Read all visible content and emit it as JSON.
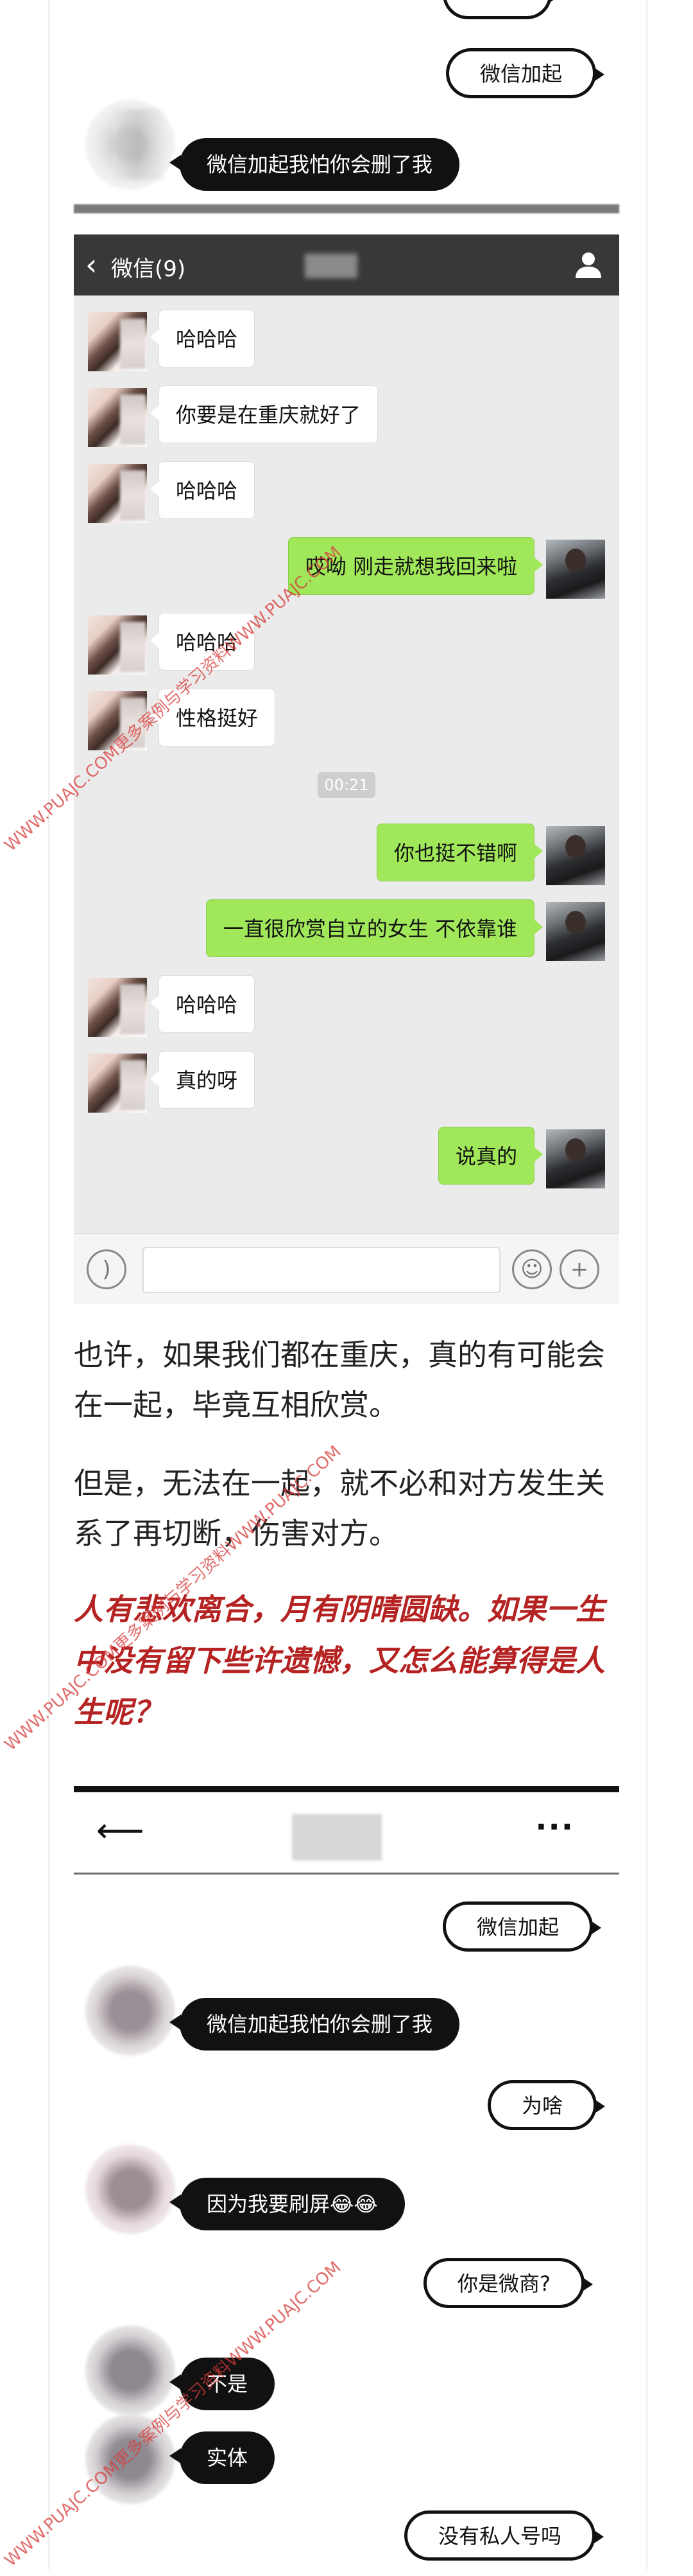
{
  "top_chat": {
    "right_bubble": "微信加起",
    "left_bubble": "微信加起我怕你会删了我"
  },
  "wechat": {
    "back_label": "微信(9)",
    "person_icon": "person-icon",
    "messages": [
      {
        "side": "left",
        "text": "哈哈哈"
      },
      {
        "side": "left",
        "text": "你要是在重庆就好了"
      },
      {
        "side": "left",
        "text": "哈哈哈"
      },
      {
        "side": "right",
        "text": "哎呦 刚走就想我回来啦"
      },
      {
        "side": "left",
        "text": "哈哈哈"
      },
      {
        "side": "left",
        "text": "性格挺好"
      },
      {
        "side": "time",
        "text": "00:21"
      },
      {
        "side": "right",
        "text": "你也挺不错啊"
      },
      {
        "side": "right",
        "text": "一直很欣赏自立的女生 不依靠谁"
      },
      {
        "side": "left",
        "text": "哈哈哈"
      },
      {
        "side": "left",
        "text": "真的呀"
      },
      {
        "side": "right",
        "text": "说真的"
      }
    ]
  },
  "article": {
    "para1": "也许，如果我们都在重庆，真的有可能会在一起，毕竟互相欣赏。",
    "para2": "但是，无法在一起，就不必和对方发生关系了再切断，伤害对方。",
    "quote": "人有悲欢离合，月有阴晴圆缺。如果一生中没有留下些许遗憾，又怎么能算得是人生呢？"
  },
  "chat2": {
    "back_icon": "back-arrow-icon",
    "more": "···",
    "messages": [
      {
        "side": "right",
        "text": "微信加起"
      },
      {
        "side": "left",
        "text": "微信加起我怕你会删了我"
      },
      {
        "side": "right",
        "text": "为啥"
      },
      {
        "side": "left",
        "text": "因为我要刷屏😂😂"
      },
      {
        "side": "right",
        "text": "你是微商?"
      },
      {
        "side": "left",
        "text": "不是"
      },
      {
        "side": "left",
        "text": "实体"
      },
      {
        "side": "right",
        "text": "没有私人号吗"
      }
    ]
  },
  "watermarks": [
    "WWW.PUAJC.COM更多案例与学习资料WWW.PUAJC.COM",
    "WWW.PUAJC.COM更多案例与学习资料WWW.PUAJC.COM",
    "WWW.PUAJC.COM更多案例与学习资料WWW.PUAJC.COM"
  ],
  "colors": {
    "green_bubble": "#a0e75a",
    "header": "#383838",
    "quote_red": "#b52222"
  }
}
